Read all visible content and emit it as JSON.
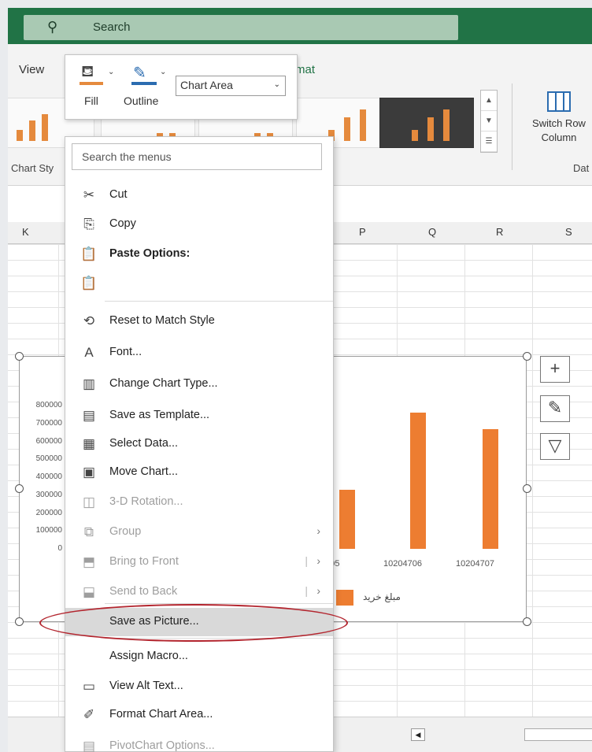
{
  "search": {
    "placeholder": "Search"
  },
  "ribbon": {
    "tab_view": "View",
    "tab_format": "rmat",
    "chart_styles_label": "Chart Sty",
    "switch_label_1": "Switch Row",
    "switch_label_2": "Column",
    "data_label": "Dat"
  },
  "mini_toolbar": {
    "fill_label": "Fill",
    "outline_label": "Outline",
    "element_select": "Chart Area"
  },
  "columns": [
    "K",
    "P",
    "Q",
    "R",
    "S"
  ],
  "context_menu": {
    "search_placeholder": "Search the menus",
    "items": [
      {
        "label": "Cut",
        "icon": "scissors-icon"
      },
      {
        "label": "Copy",
        "icon": "copy-icon"
      },
      {
        "label": "Paste Options:",
        "icon": "paste-icon"
      },
      {
        "label": "",
        "icon": "paste-keep-icon"
      },
      {
        "label": "Reset to Match Style",
        "icon": "reset-style-icon"
      },
      {
        "label": "Font...",
        "icon": "font-icon"
      },
      {
        "label": "Change Chart Type...",
        "icon": "chart-type-icon"
      },
      {
        "label": "Save as Template...",
        "icon": "template-icon"
      },
      {
        "label": "Select Data...",
        "icon": "select-data-icon"
      },
      {
        "label": "Move Chart...",
        "icon": "move-chart-icon"
      },
      {
        "label": "3-D Rotation...",
        "icon": "rotation-icon",
        "disabled": true
      },
      {
        "label": "Group",
        "icon": "group-icon",
        "disabled": true
      },
      {
        "label": "Bring to Front",
        "icon": "bring-front-icon",
        "disabled": true
      },
      {
        "label": "Send to Back",
        "icon": "send-back-icon",
        "disabled": true
      },
      {
        "label": "Save as Picture...",
        "icon": "",
        "highlighted": true
      },
      {
        "label": "Assign Macro...",
        "icon": ""
      },
      {
        "label": "View Alt Text...",
        "icon": "alt-text-icon"
      },
      {
        "label": "Format Chart Area...",
        "icon": "format-area-icon"
      },
      {
        "label": "PivotChart Options...",
        "icon": "pivot-options-icon",
        "disabled": true
      }
    ]
  },
  "chart_data": {
    "type": "bar",
    "categories": [
      "4705",
      "10204706",
      "10204707"
    ],
    "values": [
      330000,
      760000,
      670000
    ],
    "y_ticks": [
      "800000",
      "700000",
      "600000",
      "500000",
      "400000",
      "300000",
      "200000",
      "100000",
      "0"
    ],
    "ylim": [
      0,
      800000
    ],
    "legend": "مبلغ خريد",
    "bar_color": "#ed7d31"
  }
}
